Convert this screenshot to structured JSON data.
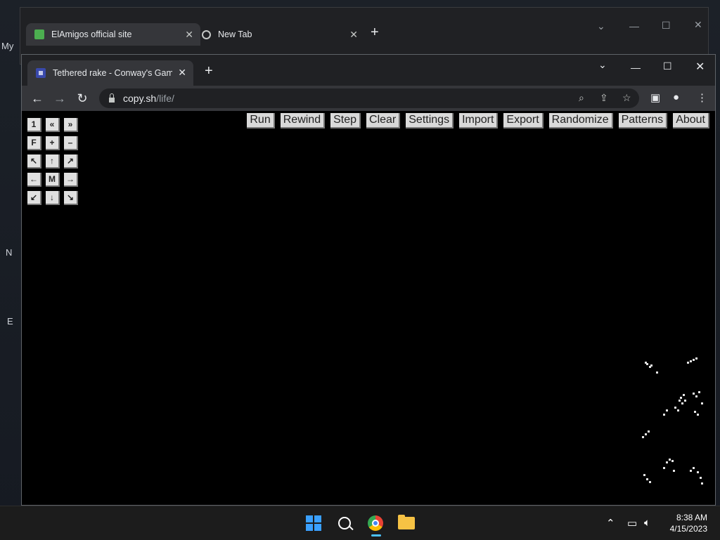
{
  "desktop": {
    "labels": [
      "My",
      "N",
      "E"
    ]
  },
  "back_window": {
    "tabs": [
      {
        "label": "ElAmigos official site",
        "icon": "elamigos-favicon-icon"
      },
      {
        "label": "New Tab",
        "icon": "chrome-icon"
      }
    ]
  },
  "front_window": {
    "tab": {
      "label": "Tethered rake - Conway's Game of Life",
      "icon": "life-favicon-icon"
    },
    "address": {
      "host": "copy.sh",
      "path": "/life/"
    }
  },
  "page": {
    "menu": [
      "Run",
      "Rewind",
      "Step",
      "Clear",
      "Settings",
      "Import",
      "Export",
      "Randomize",
      "Patterns",
      "About"
    ],
    "pad": [
      [
        "1",
        "«",
        "»"
      ],
      [
        "F",
        "+",
        "–"
      ],
      [
        "↖",
        "↑",
        "↗"
      ],
      [
        "←",
        "M",
        "→"
      ],
      [
        "↙",
        "↓",
        "↘"
      ]
    ]
  },
  "taskbar": {
    "time": "8:38 AM",
    "date": "4/15/2023"
  },
  "colors": {
    "accent": "#4cc2ff",
    "cell": "#e6e6e6",
    "chrome_bg": "#202124",
    "toolbar_bg": "#35363a"
  }
}
